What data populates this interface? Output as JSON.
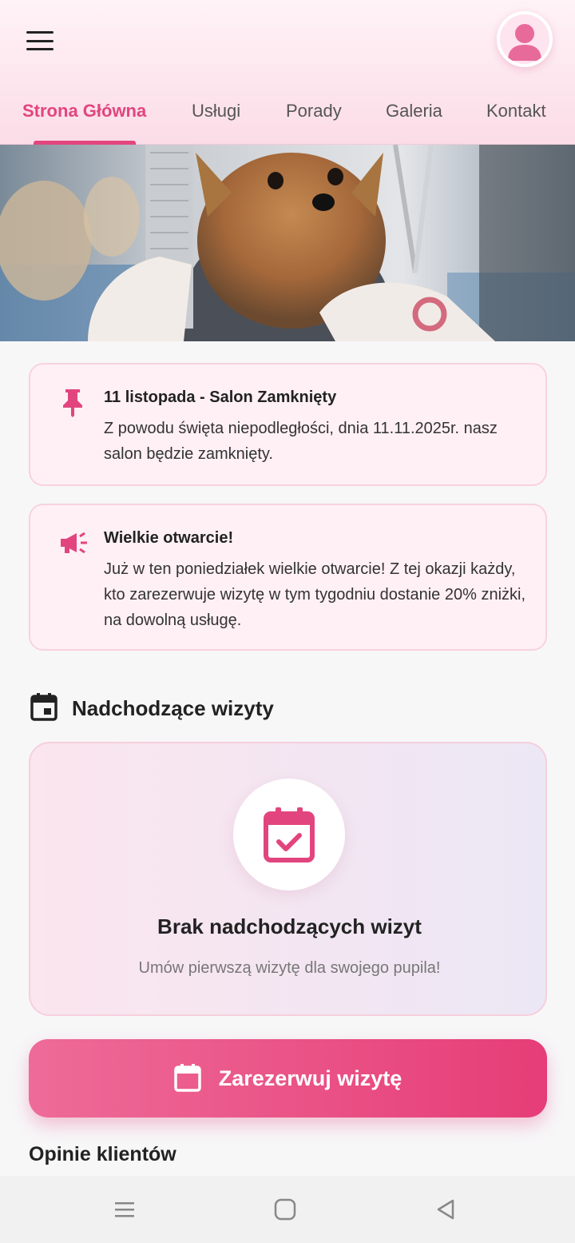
{
  "app": {
    "avatar_icon": "user-avatar-icon",
    "menu_icon": "hamburger-menu-icon"
  },
  "nav": {
    "tabs": [
      {
        "label": "Strona Główna",
        "active": true
      },
      {
        "label": "Usługi",
        "active": false
      },
      {
        "label": "Porady",
        "active": false
      },
      {
        "label": "Galeria",
        "active": false
      },
      {
        "label": "Kontakt",
        "active": false
      }
    ]
  },
  "hero": {
    "image": "yorkshire-terrier-grooming-photo"
  },
  "announcements": [
    {
      "icon": "pin-icon",
      "title": "11 listopada - Salon Zamknięty",
      "text": "Z powodu święta niepodległości, dnia 11.11.2025r. nasz salon będzie zamknięty."
    },
    {
      "icon": "megaphone-icon",
      "title": "Wielkie otwarcie!",
      "text": "Już w ten poniedziałek wielkie otwarcie! Z tej okazji każdy, kto zarezerwuje wizytę w tym tygodniu dostanie 20% zniżki, na dowolną usługę."
    }
  ],
  "upcoming": {
    "icon": "calendar-icon",
    "title": "Nadchodzące wizyty",
    "empty_icon": "calendar-check-icon",
    "empty_title": "Brak nadchodzących wizyt",
    "empty_subtitle": "Umów pierwszą wizytę dla swojego pupila!"
  },
  "book_button": {
    "icon": "calendar-icon",
    "label": "Zarezerwuj wizytę"
  },
  "reviews": {
    "title": "Opinie klientów"
  },
  "colors": {
    "accent": "#e2457e",
    "card_bg": "#fff0f5",
    "card_border": "#f8d2e0"
  },
  "system_nav": {
    "recent_icon": "recent-apps-icon",
    "home_icon": "home-icon",
    "back_icon": "back-icon"
  }
}
